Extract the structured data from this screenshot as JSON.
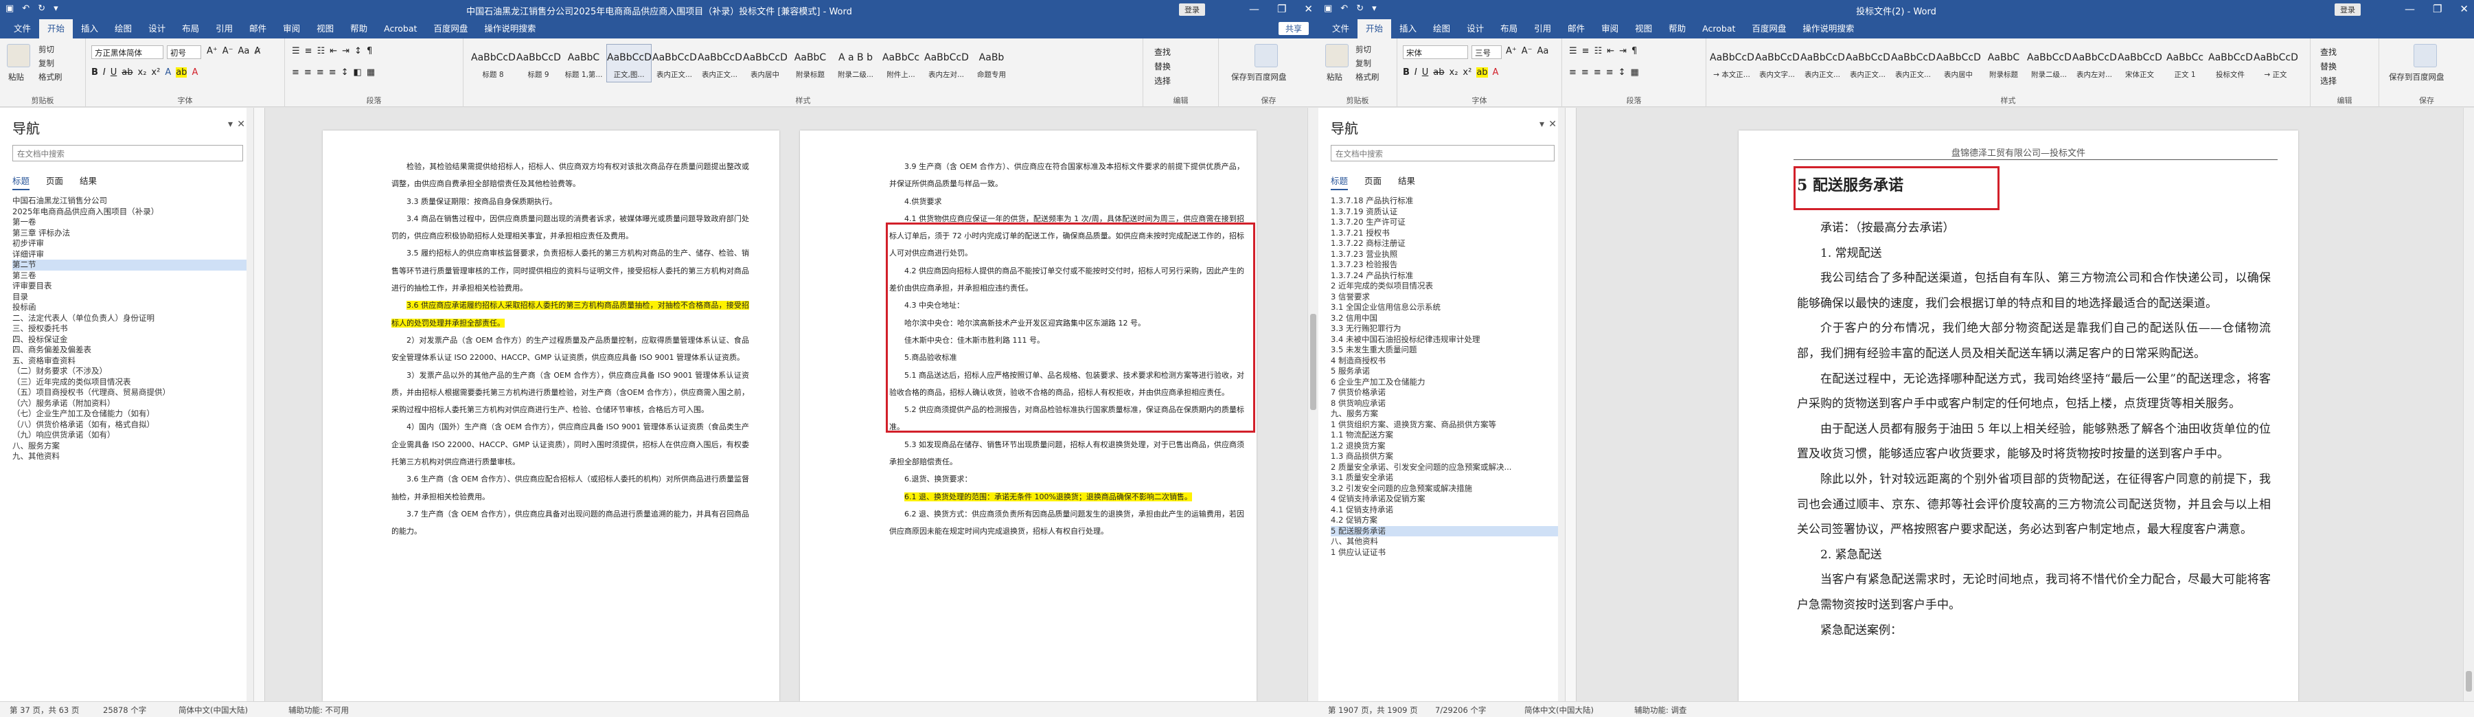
{
  "left_window": {
    "title": "中国石油黑龙江销售分公司2025年电商商品供应商入围项目（补录）投标文件 [兼容模式] - Word",
    "login": "登录",
    "tabs": [
      "文件",
      "开始",
      "插入",
      "绘图",
      "设计",
      "布局",
      "引用",
      "邮件",
      "审阅",
      "视图",
      "帮助",
      "Acrobat",
      "百度网盘",
      "操作说明搜索"
    ],
    "share": "共享",
    "ribbon": {
      "clipboard": {
        "paste": "粘贴",
        "cut": "剪切",
        "copy": "复制",
        "painter": "格式刷",
        "label": "剪贴板"
      },
      "font": {
        "name": "方正黑体简体",
        "size": "初号",
        "label": "字体"
      },
      "paragraph": {
        "label": "段落"
      },
      "styles": [
        {
          "preview": "AaBbCcDd",
          "name": "标题 8"
        },
        {
          "preview": "AaBbCcDd",
          "name": "标题 9"
        },
        {
          "preview": "AaBbC",
          "name": "标题 1,第..."
        },
        {
          "preview": "AaBbCcD",
          "name": "正文,图..."
        },
        {
          "preview": "AaBbCcDd",
          "name": "表内正文..."
        },
        {
          "preview": "AaBbCcDd",
          "name": "表内正文..."
        },
        {
          "preview": "AaBbCcDd",
          "name": "表内居中"
        },
        {
          "preview": "AaBbC",
          "name": "附录标题"
        },
        {
          "preview": "A a B b",
          "name": "附录二级..."
        },
        {
          "preview": "AaBbCc",
          "name": "附件上..."
        },
        {
          "preview": "AaBbCcDd",
          "name": "表内左对..."
        },
        {
          "preview": "AaBb",
          "name": "命题专用"
        }
      ],
      "styles_label": "样式",
      "editing": {
        "find": "查找",
        "replace": "替换",
        "select": "选择",
        "label": "编辑"
      },
      "save_net": {
        "name": "保存到百度网盘",
        "label": "保存"
      }
    },
    "nav": {
      "title": "导航",
      "search_placeholder": "在文档中搜索",
      "tabs": [
        "标题",
        "页面",
        "结果"
      ],
      "items": [
        "中国石油黑龙江销售分公司",
        "2025年电商商品供应商入围项目（补录）",
        "第一卷",
        "第三章 评标办法",
        "初步评审",
        "详细评审",
        "第二节",
        "第三卷",
        "评审要目表",
        "目录",
        "投标函",
        "二、法定代表人（单位负责人）身份证明",
        "三、授权委托书",
        "四、投标保证金",
        "四、商务偏差及偏差表",
        "五、资格审查资料",
        "（二）财务要求（不涉及）",
        "（三）近年完成的类似项目情况表",
        "（五）项目商授权书（代理商、贸易商提供）",
        "（六）服务承诺（附加资料）",
        "（七）企业生产加工及仓储能力（如有）",
        "（八）供货价格承诺（如有，格式自拟）",
        "（九）响应供货承诺（如有）",
        "八、服务方案",
        "九、其他资料"
      ]
    },
    "page1_text": [
      "检验，其检验结果需提供给招标人，招标人、供应商双方均有权对该批次商品存在质量问题提出整改或调整，由供应商自费承担全部赔偿责任及其他检验费等。",
      "3.3 质量保证期限：按商品自身保质期执行。",
      "3.4 商品在销售过程中，因供应商质量问题出现的消费者诉求，被媒体曝光或质量问题导致政府部门处罚的，供应商应积极协助招标人处理相关事宜，并承担相应责任及费用。",
      "3.5 履约招标人的供应商审核监督要求，负责招标人委托的第三方机构对商品的生产、储存、检验、销售等环节进行质量管理审核的工作，同时提供相应的资料与证明文件，接受招标人委托的第三方机构对商品进行的抽检工作，并承担相关检验费用。",
      "3.6 供应商应承诺履约招标人采取招标人委托的第三方机构商品质量抽检，对抽检不合格商品，接受招标人的处罚处理并承担全部责任。",
      "2）对发票产品（含 OEM 合作方）的生产过程质量及产品质量控制，应取得质量管理体系认证、食品安全管理体系认证 ISO 22000、HACCP、GMP 认证资质，供应商应具备 ISO 9001 管理体系认证资质。",
      "3）发票产品以外的其他产品的生产商（含 OEM 合作方），供应商应具备 ISO 9001 管理体系认证资质，并由招标人根据需要委托第三方机构进行质量检验，对生产商（含OEM 合作方），供应商需入围之前，采购过程中招标人委托第三方机构对供应商进行生产、检验、仓储环节审核，合格后方可入围。",
      "4）国内（国外）生产商（含 OEM 合作方），供应商应具备 ISO 9001 管理体系认证资质（食品类生产企业需具备 ISO 22000、HACCP、GMP 认证资质），同时入围时须提供，招标人在供应商入围后，有权委托第三方机构对供应商进行质量审核。",
      "3.6 生产商（含 OEM 合作方）、供应商应配合招标人（或招标人委托的机构）对所供商品进行质量监督抽检，并承担相关检验费用。",
      "3.7 生产商（含 OEM 合作方），供应商应具备对出现问题的商品进行质量追溯的能力，并具有召回商品的能力。"
    ],
    "page2_text": [
      "3.9 生产商（含 OEM 合作方）、供应商应在符合国家标准及本招标文件要求的前提下提供优质产品，并保证所供商品质量与样品一致。",
      "4.供货要求",
      "4.1 供货物供应商应保证一年的供货，配送频率为 1 次/周，具体配送时间为周三，供应商需在接到招标人订单后，须于 72 小时内完成订单的配送工作，确保商品质量。如供应商未按时完成配送工作的，招标人可对供应商进行处罚。",
      "4.2 供应商因向招标人提供的商品不能按订单交付或不能按时交付时，招标人可另行采购，因此产生的差价由供应商承担，并承担相应违约责任。",
      "4.3 中央仓地址：",
      "哈尔滨中央仓：哈尔滨高新技术产业开发区迎宾路集中区东湖路 12 号。",
      "佳木斯中央仓：佳木斯市胜利路 111 号。",
      "5.商品验收标准",
      "5.1 商品送达后，招标人应严格按照订单、品名规格、包装要求、技术要求和检测方案等进行验收，对验收合格的商品，招标人确认收货，验收不合格的商品，招标人有权拒收，并由供应商承担相应责任。",
      "5.2 供应商须提供产品的检测报告，对商品检验标准执行国家质量标准，保证商品在保质期内的质量标准。",
      "5.3 如发现商品在储存、销售环节出现质量问题，招标人有权退换货处理，对于已售出商品，供应商须承担全部赔偿责任。",
      "6.退货、换货要求：",
      "6.1 退、换货处理的范围：承诺无条件 100%退换货；退换商品确保不影响二次销售。",
      "6.2 退、换货方式：供应商须负责所有因商品质量问题发生的退换货，承担由此产生的运输费用，若因供应商原因未能在规定时间内完成退换货，招标人有权自行处理。"
    ],
    "status": {
      "page": "第 37 页，共 63 页",
      "words": "25878 个字",
      "lang": "简体中文(中国大陆)",
      "access": "辅助功能: 不可用"
    }
  },
  "right_window": {
    "title": "投标文件(2) - Word",
    "login": "登录",
    "tabs": [
      "文件",
      "开始",
      "插入",
      "绘图",
      "设计",
      "布局",
      "引用",
      "邮件",
      "审阅",
      "视图",
      "帮助",
      "Acrobat",
      "百度网盘",
      "操作说明搜索"
    ],
    "ribbon": {
      "font": {
        "name": "宋体",
        "size": "三号",
        "label": "字体"
      },
      "paragraph": {
        "label": "段落"
      },
      "styles": [
        {
          "preview": "AaBbCcDd",
          "name": "→ 本文正..."
        },
        {
          "preview": "AaBbCcDd",
          "name": "表内文字..."
        },
        {
          "preview": "AaBbCcDd",
          "name": "表内正文..."
        },
        {
          "preview": "AaBbCcDd",
          "name": "表内正文..."
        },
        {
          "preview": "AaBbCcDd",
          "name": "表内正文..."
        },
        {
          "preview": "AaBbCcDd",
          "name": "表内居中"
        },
        {
          "preview": "AaBbC",
          "name": "附录标题"
        },
        {
          "preview": "AaBbCcD",
          "name": "附录二级..."
        },
        {
          "preview": "AaBbCcDd",
          "name": "表内左对..."
        },
        {
          "preview": "AaBbCcDd",
          "name": "宋体正文"
        },
        {
          "preview": "AaBbCc",
          "name": "正文 1"
        },
        {
          "preview": "AaBbCcDd",
          "name": "投标文件"
        },
        {
          "preview": "AaBbCcD",
          "name": "→ 正文"
        }
      ],
      "styles_label": "样式",
      "editing": {
        "find": "查找",
        "replace": "替换",
        "select": "选择",
        "label": "编辑"
      },
      "save_net": {
        "name": "保存到百度网盘",
        "label": "保存"
      }
    },
    "nav": {
      "title": "导航",
      "search_placeholder": "在文档中搜索",
      "tabs": [
        "标题",
        "页面",
        "结果"
      ],
      "items": [
        "1.3.7.18 产品执行标准",
        "1.3.7.19 资质认证",
        "1.3.7.20 生产许可证",
        "1.3.7.21 授权书",
        "1.3.7.22 商标注册证",
        "1.3.7.23 营业执照",
        "1.3.7.23 检验报告",
        "1.3.7.24 产品执行标准",
        "2 近年完成的类似项目情况表",
        "3 信誉要求",
        "3.1 全国企业信用信息公示系统",
        "3.2 信用中国",
        "3.3 无行贿犯罪行为",
        "3.4 未被中国石油招投标纪律违规审计处理",
        "3.5 未发生重大质量问题",
        "4 制造商授权书",
        "5 服务承诺",
        "6 企业生产加工及仓储能力",
        "7 供货价格承诺",
        "8 供货响应承诺",
        "九、服务方案",
        "1 供货组织方案、退换货方案、商品损供方案等",
        "1.1 物流配送方案",
        "1.2 退换货方案",
        "1.3 商品损供方案",
        "2 质量安全承诺、引发安全问题的应急预案或解决...",
        "3.1 质量安全承诺",
        "3.2 引发安全问题的应急预案或解决措施",
        "4 促销支持承诺及促销方案",
        "4.1 促销支持承诺",
        "4.2 促销方案",
        "5 配送服务承诺",
        "八、其他资料",
        "1 供应认证证书"
      ]
    },
    "page": {
      "header": "盘锦德泽工贸有限公司—投标文件",
      "heading": "5  配送服务承诺",
      "paragraphs": [
        "承诺：（按最高分去承诺）",
        "1. 常规配送",
        "我公司结合了多种配送渠道，包括自有车队、第三方物流公司和合作快递公司，以确保能够确保以最快的速度，我们会根据订单的特点和目的地选择最适合的配送渠道。",
        "介于客户的分布情况，我们绝大部分物资配送是靠我们自己的配送队伍——仓储物流部，我们拥有经验丰富的配送人员及相关配送车辆以满足客户的日常采购配送。",
        "在配送过程中，无论选择哪种配送方式，我司始终坚持“最后一公里”的配送理念，将客户采购的货物送到客户手中或客户制定的任何地点，包括上楼，点货理货等相关服务。",
        "由于配送人员都有服务于油田 5 年以上相关经验，能够熟悉了解各个油田收货单位的位置及收货习惯，能够适应客户收货要求，能够及时将货物按时按量的送到客户手中。",
        "除此以外，针对较远距离的个别外省项目部的货物配送，在征得客户同意的前提下，我司也会通过顺丰、京东、德邦等社会评价度较高的三方物流公司配送货物，并且会与以上相关公司签署协议，严格按照客户要求配送，务必达到客户制定地点，最大程度客户满意。",
        "2. 紧急配送",
        "当客户有紧急配送需求时，无论时间地点，我司将不惜代价全力配合，尽最大可能将客户急需物资按时送到客户手中。",
        "紧急配送案例："
      ]
    },
    "status": {
      "page": "第 1907 页，共 1909 页",
      "words": "7/29206 个字",
      "lang": "简体中文(中国大陆)",
      "access": "辅助功能: 调查"
    }
  },
  "colors": {
    "accent": "#2b579a",
    "highlight": "#fff200",
    "annotation": "#d2202a"
  }
}
